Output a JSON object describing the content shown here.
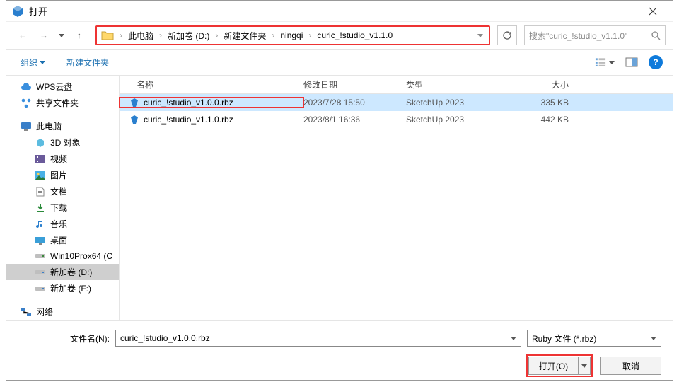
{
  "title": "打开",
  "nav": {
    "back": "←",
    "forward": "→",
    "up": "↑"
  },
  "breadcrumb": [
    "此电脑",
    "新加卷 (D:)",
    "新建文件夹",
    "ningqi",
    "curic_!studio_v1.1.0"
  ],
  "search": {
    "placeholder": "搜索\"curic_!studio_v1.1.0\""
  },
  "toolbar": {
    "organize": "组织",
    "newfolder": "新建文件夹"
  },
  "columns": {
    "name": "名称",
    "date": "修改日期",
    "type": "类型",
    "size": "大小"
  },
  "sidebar": {
    "wps": "WPS云盘",
    "shared": "共享文件夹",
    "thispc": "此电脑",
    "items": [
      {
        "label": "3D 对象"
      },
      {
        "label": "视频"
      },
      {
        "label": "图片"
      },
      {
        "label": "文档"
      },
      {
        "label": "下载"
      },
      {
        "label": "音乐"
      },
      {
        "label": "桌面"
      },
      {
        "label": "Win10Prox64 (C"
      },
      {
        "label": "新加卷 (D:)"
      },
      {
        "label": "新加卷 (F:)"
      }
    ],
    "network": "网络"
  },
  "files": [
    {
      "name": "curic_!studio_v1.0.0.rbz",
      "date": "2023/7/28 15:50",
      "type": "SketchUp 2023",
      "size": "335 KB",
      "selected": true
    },
    {
      "name": "curic_!studio_v1.1.0.rbz",
      "date": "2023/8/1 16:36",
      "type": "SketchUp 2023",
      "size": "442 KB",
      "selected": false
    }
  ],
  "footer": {
    "fn_label": "文件名(N):",
    "fn_value": "curic_!studio_v1.0.0.rbz",
    "filter": "Ruby 文件 (*.rbz)",
    "open": "打开(O)",
    "cancel": "取消"
  }
}
